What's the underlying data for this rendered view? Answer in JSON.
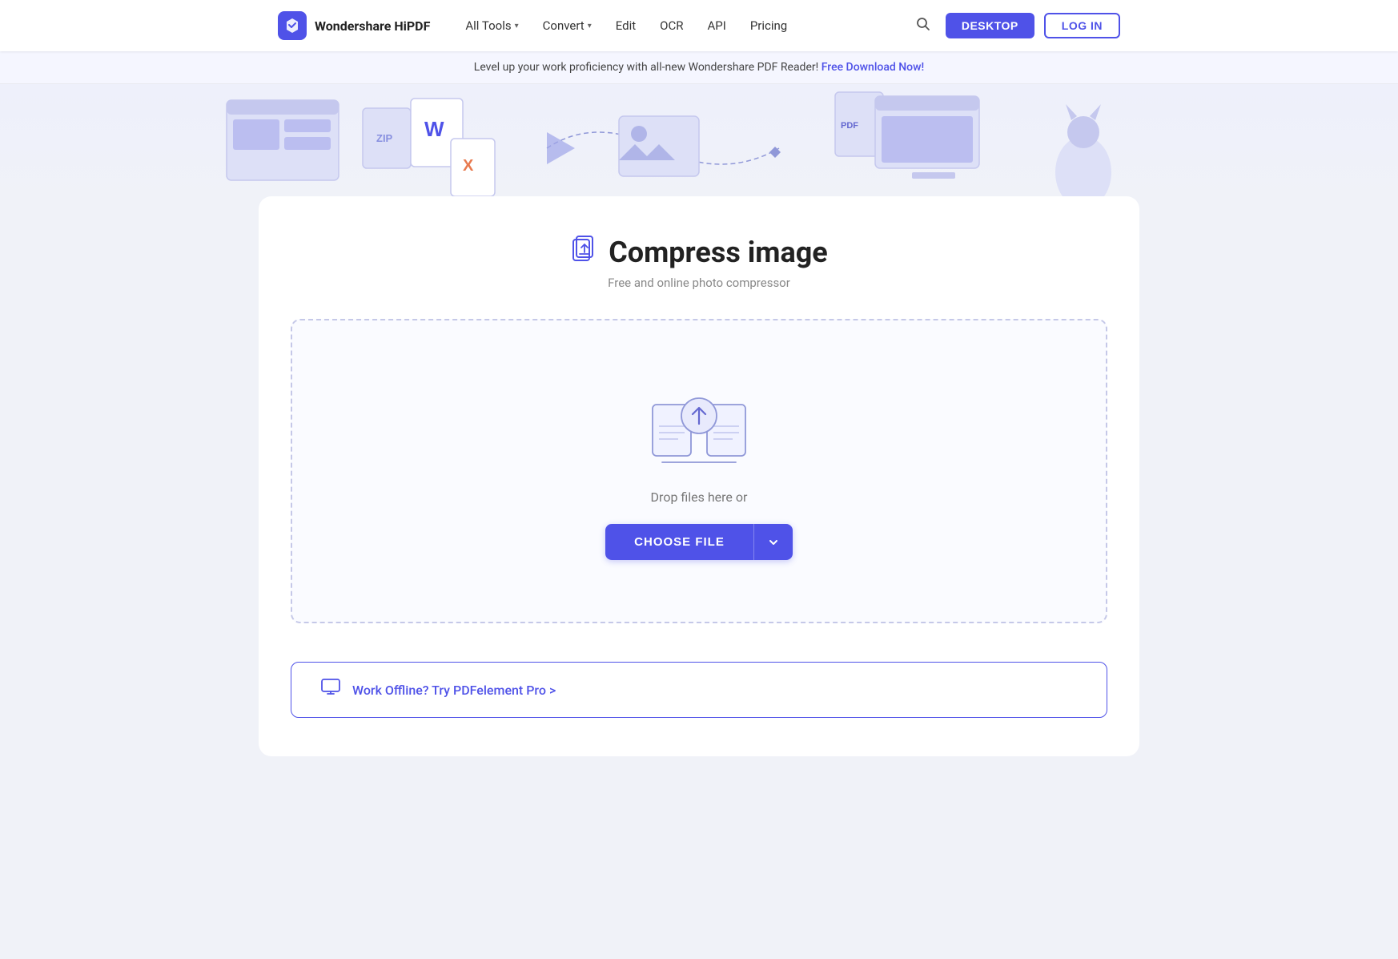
{
  "brand": {
    "name": "Wondershare HiPDF",
    "logo_bg": "#4f52e8"
  },
  "navbar": {
    "all_tools_label": "All Tools",
    "convert_label": "Convert",
    "edit_label": "Edit",
    "ocr_label": "OCR",
    "api_label": "API",
    "pricing_label": "Pricing",
    "desktop_button": "DESKTOP",
    "login_button": "LOG IN"
  },
  "banner": {
    "text": "Level up your work proficiency with all-new Wondershare PDF Reader!",
    "link_text": "Free Download Now!"
  },
  "tool": {
    "title": "Compress image",
    "subtitle": "Free and online photo compressor",
    "drop_text": "Drop files here or",
    "choose_file_label": "CHOOSE FILE",
    "offline_text": "Work Offline? Try PDFelement Pro >"
  },
  "colors": {
    "primary": "#4f52e8",
    "primary_dark": "#3d40d4"
  }
}
